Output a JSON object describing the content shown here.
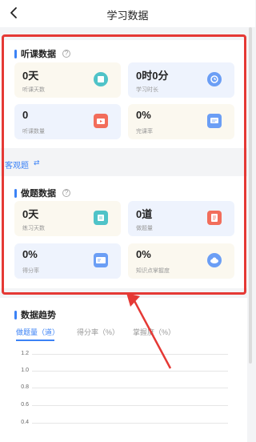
{
  "header": {
    "title": "学习数据"
  },
  "listening": {
    "title": "听课数据",
    "cards": [
      {
        "value": "0天",
        "label": "听课天数",
        "icon": "book-icon"
      },
      {
        "value": "0时0分",
        "label": "学习时长",
        "icon": "clock-icon"
      },
      {
        "value": "0",
        "label": "听课数量",
        "icon": "video-icon"
      },
      {
        "value": "0%",
        "label": "完课率",
        "icon": "chat-icon"
      }
    ]
  },
  "objective": {
    "label": "客观题"
  },
  "practice": {
    "title": "做题数据",
    "cards": [
      {
        "value": "0天",
        "label": "练习天数",
        "icon": "calendar-icon"
      },
      {
        "value": "0道",
        "label": "做题量",
        "icon": "document-icon"
      },
      {
        "value": "0%",
        "label": "得分率",
        "icon": "score-card-icon"
      },
      {
        "value": "0%",
        "label": "知识点掌握度",
        "icon": "cloud-icon"
      }
    ]
  },
  "trend": {
    "title": "数据趋势",
    "tabs": [
      "做题量（道）",
      "得分率（%）",
      "掌握度（%）"
    ]
  },
  "chart_data": {
    "type": "line",
    "yticks": [
      "1.2",
      "1.0",
      "0.8",
      "0.6",
      "0.4"
    ],
    "series": []
  },
  "colors": {
    "accent": "#3b82f6",
    "highlight": "#e53935"
  }
}
